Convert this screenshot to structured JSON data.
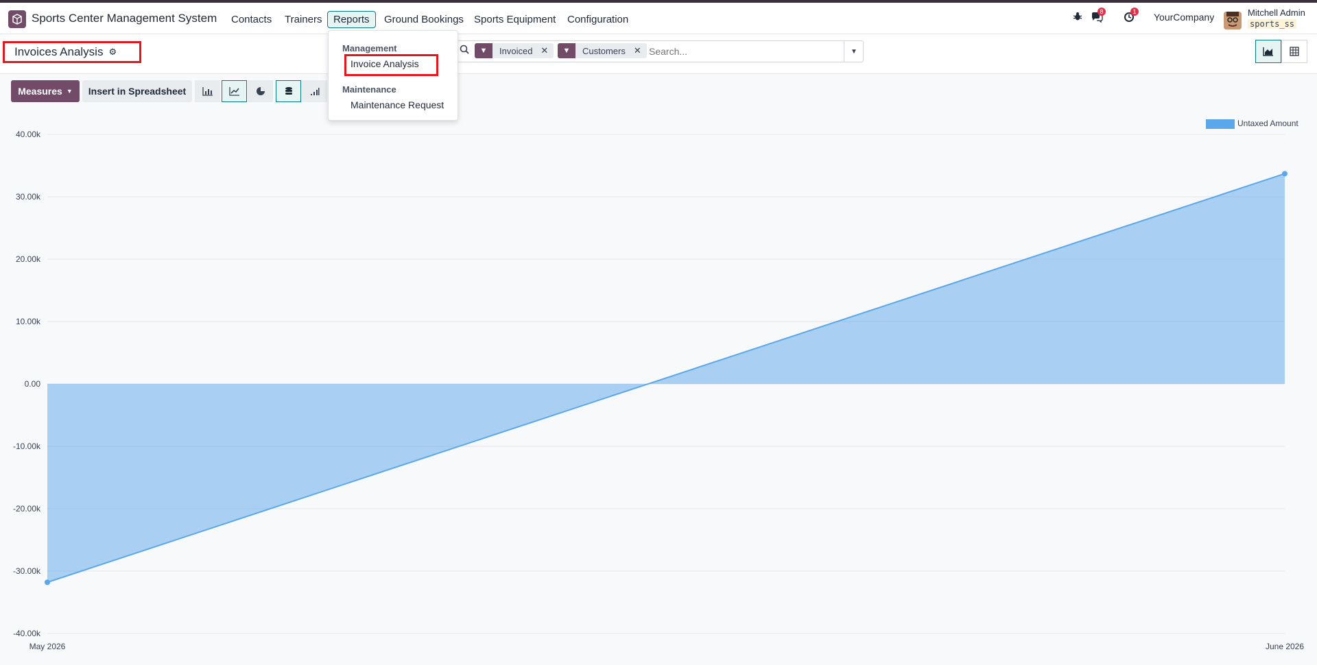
{
  "app": {
    "name": "Sports Center Management System"
  },
  "nav": {
    "menus": [
      {
        "label": "Contacts"
      },
      {
        "label": "Trainers"
      },
      {
        "label": "Reports"
      },
      {
        "label": "Ground Bookings"
      },
      {
        "label": "Sports Equipment"
      },
      {
        "label": "Configuration"
      }
    ],
    "active_menu": "Reports"
  },
  "systray": {
    "messages_count": "8",
    "activities_count": "1",
    "company": "YourCompany",
    "user_name": "Mitchell Admin",
    "user_db": "sports_ss"
  },
  "breadcrumb": {
    "title": "Invoices Analysis"
  },
  "search": {
    "facets": [
      {
        "label": "Invoiced"
      },
      {
        "label": "Customers"
      }
    ],
    "placeholder": "Search..."
  },
  "toolbar": {
    "measures_label": "Measures",
    "spreadsheet_label": "Insert in Spreadsheet"
  },
  "reports_dropdown": {
    "sections": [
      {
        "header": "Management",
        "items": [
          {
            "label": "Invoice Analysis"
          }
        ]
      },
      {
        "header": "Maintenance",
        "items": [
          {
            "label": "Maintenance Request"
          }
        ]
      }
    ]
  },
  "colors": {
    "accent": "#714b67",
    "teal": "#017e84",
    "series": "#5aa7ec",
    "highlight": "#e3161b"
  },
  "chart_data": {
    "type": "area",
    "x": [
      "May 2026",
      "June 2026"
    ],
    "series": [
      {
        "name": "Untaxed Amount",
        "values": [
          -31800,
          33700
        ]
      }
    ],
    "ylim": [
      -40000,
      40000
    ],
    "yticks": [
      "40.00k",
      "30.00k",
      "20.00k",
      "10.00k",
      "0.00",
      "-10.00k",
      "-20.00k",
      "-30.00k",
      "-40.00k"
    ],
    "legend_position": "top-right",
    "grid": true
  }
}
